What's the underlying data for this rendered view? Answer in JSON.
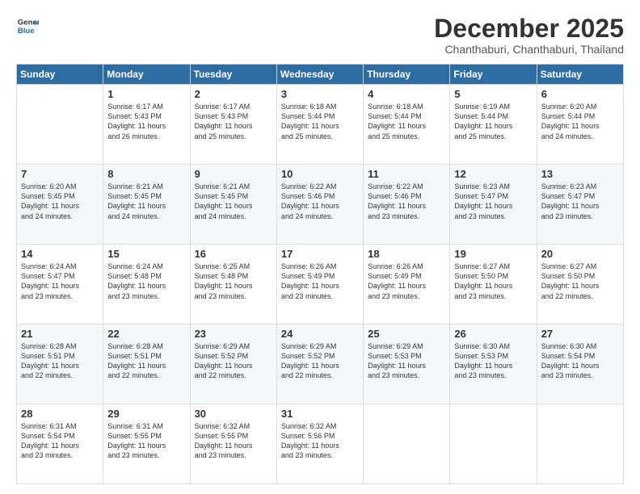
{
  "header": {
    "logo": {
      "line1": "General",
      "line2": "Blue"
    },
    "title": "December 2025",
    "subtitle": "Chanthaburi, Chanthaburi, Thailand"
  },
  "weekdays": [
    "Sunday",
    "Monday",
    "Tuesday",
    "Wednesday",
    "Thursday",
    "Friday",
    "Saturday"
  ],
  "weeks": [
    [
      {
        "day": "",
        "info": ""
      },
      {
        "day": "1",
        "info": "Sunrise: 6:17 AM\nSunset: 5:43 PM\nDaylight: 11 hours\nand 26 minutes."
      },
      {
        "day": "2",
        "info": "Sunrise: 6:17 AM\nSunset: 5:43 PM\nDaylight: 11 hours\nand 25 minutes."
      },
      {
        "day": "3",
        "info": "Sunrise: 6:18 AM\nSunset: 5:44 PM\nDaylight: 11 hours\nand 25 minutes."
      },
      {
        "day": "4",
        "info": "Sunrise: 6:18 AM\nSunset: 5:44 PM\nDaylight: 11 hours\nand 25 minutes."
      },
      {
        "day": "5",
        "info": "Sunrise: 6:19 AM\nSunset: 5:44 PM\nDaylight: 11 hours\nand 25 minutes."
      },
      {
        "day": "6",
        "info": "Sunrise: 6:20 AM\nSunset: 5:44 PM\nDaylight: 11 hours\nand 24 minutes."
      }
    ],
    [
      {
        "day": "7",
        "info": "Sunrise: 6:20 AM\nSunset: 5:45 PM\nDaylight: 11 hours\nand 24 minutes."
      },
      {
        "day": "8",
        "info": "Sunrise: 6:21 AM\nSunset: 5:45 PM\nDaylight: 11 hours\nand 24 minutes."
      },
      {
        "day": "9",
        "info": "Sunrise: 6:21 AM\nSunset: 5:45 PM\nDaylight: 11 hours\nand 24 minutes."
      },
      {
        "day": "10",
        "info": "Sunrise: 6:22 AM\nSunset: 5:46 PM\nDaylight: 11 hours\nand 24 minutes."
      },
      {
        "day": "11",
        "info": "Sunrise: 6:22 AM\nSunset: 5:46 PM\nDaylight: 11 hours\nand 23 minutes."
      },
      {
        "day": "12",
        "info": "Sunrise: 6:23 AM\nSunset: 5:47 PM\nDaylight: 11 hours\nand 23 minutes."
      },
      {
        "day": "13",
        "info": "Sunrise: 6:23 AM\nSunset: 5:47 PM\nDaylight: 11 hours\nand 23 minutes."
      }
    ],
    [
      {
        "day": "14",
        "info": "Sunrise: 6:24 AM\nSunset: 5:47 PM\nDaylight: 11 hours\nand 23 minutes."
      },
      {
        "day": "15",
        "info": "Sunrise: 6:24 AM\nSunset: 5:48 PM\nDaylight: 11 hours\nand 23 minutes."
      },
      {
        "day": "16",
        "info": "Sunrise: 6:25 AM\nSunset: 5:48 PM\nDaylight: 11 hours\nand 23 minutes."
      },
      {
        "day": "17",
        "info": "Sunrise: 6:26 AM\nSunset: 5:49 PM\nDaylight: 11 hours\nand 23 minutes."
      },
      {
        "day": "18",
        "info": "Sunrise: 6:26 AM\nSunset: 5:49 PM\nDaylight: 11 hours\nand 23 minutes."
      },
      {
        "day": "19",
        "info": "Sunrise: 6:27 AM\nSunset: 5:50 PM\nDaylight: 11 hours\nand 23 minutes."
      },
      {
        "day": "20",
        "info": "Sunrise: 6:27 AM\nSunset: 5:50 PM\nDaylight: 11 hours\nand 22 minutes."
      }
    ],
    [
      {
        "day": "21",
        "info": "Sunrise: 6:28 AM\nSunset: 5:51 PM\nDaylight: 11 hours\nand 22 minutes."
      },
      {
        "day": "22",
        "info": "Sunrise: 6:28 AM\nSunset: 5:51 PM\nDaylight: 11 hours\nand 22 minutes."
      },
      {
        "day": "23",
        "info": "Sunrise: 6:29 AM\nSunset: 5:52 PM\nDaylight: 11 hours\nand 22 minutes."
      },
      {
        "day": "24",
        "info": "Sunrise: 6:29 AM\nSunset: 5:52 PM\nDaylight: 11 hours\nand 22 minutes."
      },
      {
        "day": "25",
        "info": "Sunrise: 6:29 AM\nSunset: 5:53 PM\nDaylight: 11 hours\nand 23 minutes."
      },
      {
        "day": "26",
        "info": "Sunrise: 6:30 AM\nSunset: 5:53 PM\nDaylight: 11 hours\nand 23 minutes."
      },
      {
        "day": "27",
        "info": "Sunrise: 6:30 AM\nSunset: 5:54 PM\nDaylight: 11 hours\nand 23 minutes."
      }
    ],
    [
      {
        "day": "28",
        "info": "Sunrise: 6:31 AM\nSunset: 5:54 PM\nDaylight: 11 hours\nand 23 minutes."
      },
      {
        "day": "29",
        "info": "Sunrise: 6:31 AM\nSunset: 5:55 PM\nDaylight: 11 hours\nand 23 minutes."
      },
      {
        "day": "30",
        "info": "Sunrise: 6:32 AM\nSunset: 5:55 PM\nDaylight: 11 hours\nand 23 minutes."
      },
      {
        "day": "31",
        "info": "Sunrise: 6:32 AM\nSunset: 5:56 PM\nDaylight: 11 hours\nand 23 minutes."
      },
      {
        "day": "",
        "info": ""
      },
      {
        "day": "",
        "info": ""
      },
      {
        "day": "",
        "info": ""
      }
    ]
  ]
}
